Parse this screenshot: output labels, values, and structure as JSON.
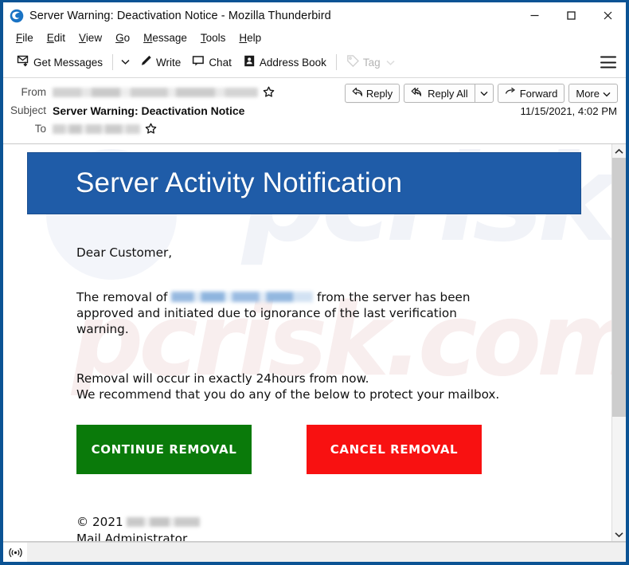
{
  "window": {
    "title": "Server Warning: Deactivation Notice - Mozilla Thunderbird",
    "logo_icon": "thunderbird-logo-icon",
    "controls": {
      "minimize": "minimize-icon",
      "maximize": "maximize-icon",
      "close": "close-icon"
    },
    "border_color": "#0b5394"
  },
  "menubar": {
    "items": [
      {
        "label": "File",
        "accel": "F"
      },
      {
        "label": "Edit",
        "accel": "E"
      },
      {
        "label": "View",
        "accel": "V"
      },
      {
        "label": "Go",
        "accel": "G"
      },
      {
        "label": "Message",
        "accel": "M"
      },
      {
        "label": "Tools",
        "accel": "T"
      },
      {
        "label": "Help",
        "accel": "H"
      }
    ]
  },
  "toolbar": {
    "get_messages": "Get Messages",
    "get_messages_icon": "get-messages-icon",
    "get_messages_caret": "chevron-down-icon",
    "write": "Write",
    "write_icon": "pencil-icon",
    "chat": "Chat",
    "chat_icon": "chat-bubble-icon",
    "address_book": "Address Book",
    "address_book_icon": "address-book-icon",
    "tag": "Tag",
    "tag_icon": "tag-icon",
    "tag_caret": "chevron-down-icon",
    "tag_disabled": true,
    "app_menu_icon": "hamburger-menu-icon"
  },
  "message_header": {
    "from_label": "From",
    "from_value_redacted": true,
    "from_star_icon": "star-outline-icon",
    "subject_label": "Subject",
    "subject_value": "Server Warning: Deactivation Notice",
    "to_label": "To",
    "to_value_redacted": true,
    "to_star_icon": "star-outline-icon",
    "date": "11/15/2021, 4:02 PM",
    "actions": {
      "reply": "Reply",
      "reply_icon": "reply-arrow-icon",
      "reply_all": "Reply All",
      "reply_all_icon": "reply-all-arrow-icon",
      "reply_all_caret": "chevron-down-icon",
      "forward": "Forward",
      "forward_icon": "forward-arrow-icon",
      "more": "More",
      "more_caret": "chevron-down-icon"
    }
  },
  "email": {
    "banner_title": "Server Activity Notification",
    "banner_color": "#1f5ca8",
    "greeting": "Dear Customer,",
    "paragraph1_before": "The removal of ",
    "paragraph1_after": " from the server has been approved and initiated due to ignorance of the last verification warning.",
    "paragraph1_redacted_link": true,
    "paragraph2_line1": "Removal will occur in exactly 24hours from now.",
    "paragraph2_line2": "We recommend that you do any of the below to protect your mailbox.",
    "buttons": [
      {
        "label": "CONTINUE REMOVAL",
        "color": "#0a7a0a",
        "style": "green"
      },
      {
        "label": "CANCEL REMOVAL",
        "color": "#f81111",
        "style": "red"
      }
    ],
    "footer_copyright": "© 2021",
    "footer_redacted": true,
    "footer_signature": "Mail Administrator",
    "watermark_text": "pcrisk.com"
  },
  "scrollbar": {
    "up_icon": "chevron-up-icon",
    "down_icon": "chevron-down-icon",
    "thumb_position_pct": 0,
    "thumb_size_pct": 70
  },
  "statusbar": {
    "connection_icon": "network-activity-icon",
    "text": ""
  }
}
